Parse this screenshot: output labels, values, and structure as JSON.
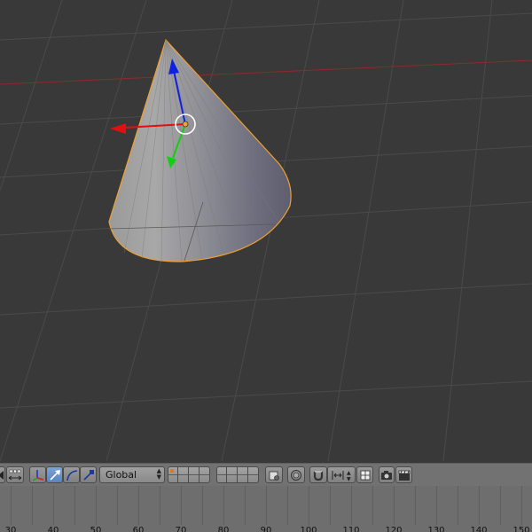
{
  "viewport": {
    "object": "Cone",
    "selected": true,
    "colors": {
      "background": "#393939",
      "grid": "#4a4a4a",
      "x_axis": "#8e2a2a",
      "selection_outline": "#f0a030",
      "gizmo_x": "#e01010",
      "gizmo_y": "#10d010",
      "gizmo_z": "#1020e0"
    }
  },
  "header": {
    "transform_orientation": "Global",
    "buttons": [
      "view-toggle",
      "manipulator-toggle",
      "translate-manipulator",
      "rotate-manipulator",
      "scale-manipulator",
      "pivot",
      "proportional-editing",
      "snap",
      "snap-element",
      "render-opengl",
      "render-animation"
    ]
  },
  "timeline": {
    "tick_labels": [
      "30",
      "40",
      "50",
      "60",
      "70",
      "80",
      "90",
      "100",
      "110",
      "120",
      "130",
      "140",
      "150"
    ]
  }
}
